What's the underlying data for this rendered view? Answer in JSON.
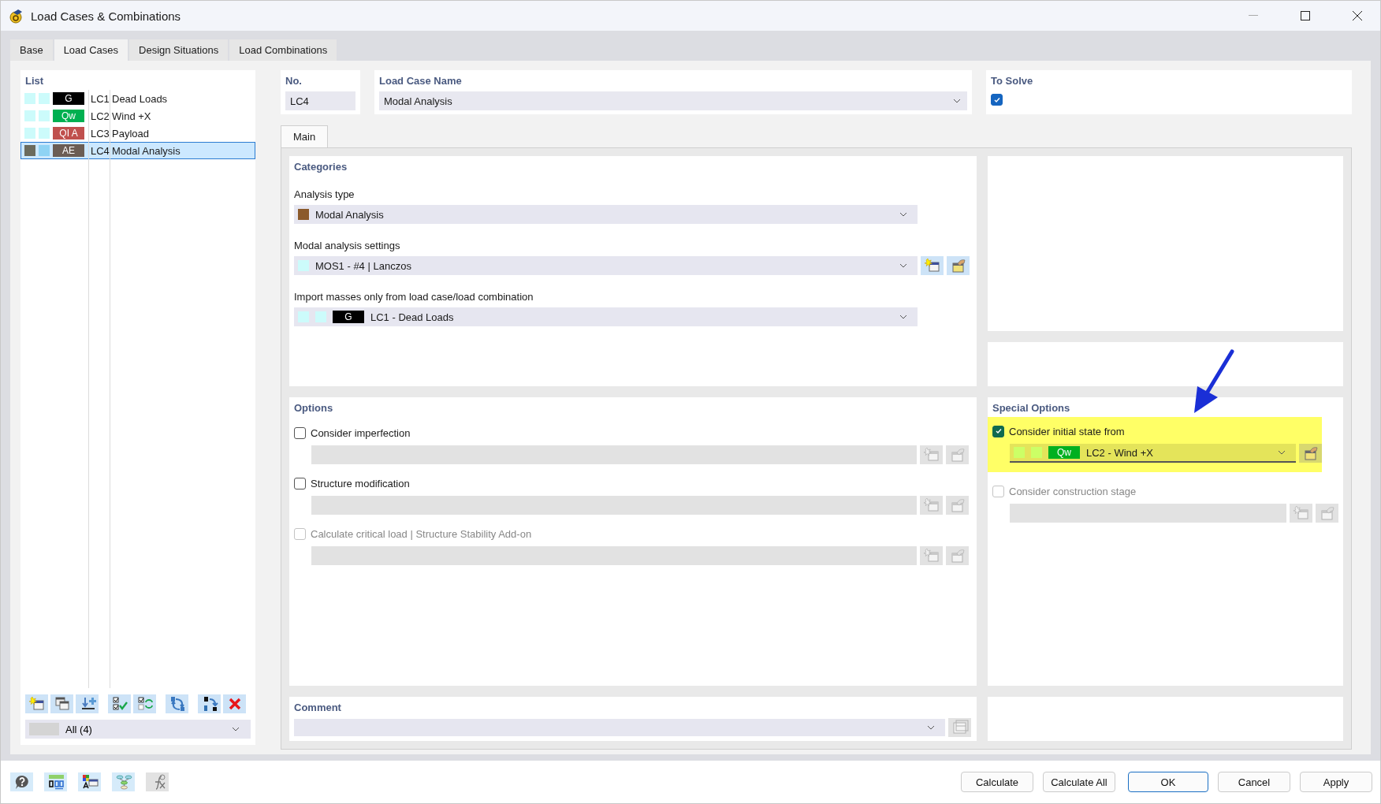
{
  "window": {
    "title": "Load Cases & Combinations"
  },
  "tabs": [
    {
      "label": "Base",
      "selected": false
    },
    {
      "label": "Load Cases",
      "selected": true
    },
    {
      "label": "Design Situations",
      "selected": false
    },
    {
      "label": "Load Combinations",
      "selected": false
    }
  ],
  "list": {
    "heading": "List",
    "items": [
      {
        "swatches": [
          {
            "color": "#ccfbfb"
          },
          {
            "color": "#ccfbfb"
          }
        ],
        "badge": {
          "text": "G",
          "color": "#000000"
        },
        "code": "LC1",
        "name": "Dead Loads",
        "selected": false
      },
      {
        "swatches": [
          {
            "color": "#ccfbfb"
          },
          {
            "color": "#ccfbfb"
          }
        ],
        "badge": {
          "text": "Qw",
          "color": "#00b050"
        },
        "code": "LC2",
        "name": "Wind +X",
        "selected": false
      },
      {
        "swatches": [
          {
            "color": "#ccfbfb"
          },
          {
            "color": "#ccfbfb"
          }
        ],
        "badge": {
          "text": "QI A",
          "color": "#c0504d"
        },
        "code": "LC3",
        "name": "Payload",
        "selected": false
      },
      {
        "swatches": [
          {
            "color": "#6b6b5e"
          },
          {
            "color": "#8fd3f4"
          }
        ],
        "badge": {
          "text": "AE",
          "color": "#6b5d54"
        },
        "code": "LC4",
        "name": "Modal Analysis",
        "selected": true
      }
    ],
    "filter": {
      "value": "All (4)"
    }
  },
  "number": {
    "label": "No.",
    "value": "LC4"
  },
  "load_case_name": {
    "label": "Load Case Name",
    "value": "Modal Analysis"
  },
  "to_solve": {
    "label": "To Solve",
    "checked": true
  },
  "section_tabs": [
    {
      "label": "Main",
      "selected": true
    }
  ],
  "categories": {
    "heading": "Categories",
    "fields": [
      {
        "label": "Analysis type",
        "value": "Modal Analysis",
        "swatches": [
          {
            "color": "#8b5a2b"
          }
        ],
        "actions": false
      },
      {
        "label": "Modal analysis settings",
        "value": "MOS1 - #4 | Lanczos",
        "swatches": [
          {
            "color": "#ccfbfb"
          }
        ],
        "actions": true
      },
      {
        "label": "Import masses only from load case/load combination",
        "value": "LC1 - Dead Loads",
        "swatches": [
          {
            "color": "#ccfbfb"
          },
          {
            "color": "#ccfbfb"
          }
        ],
        "badge": {
          "text": "G",
          "color": "#000000"
        },
        "actions": false
      }
    ]
  },
  "options": {
    "heading": "Options",
    "items": [
      {
        "label": "Consider imperfection",
        "checked": false,
        "disabled": false
      },
      {
        "label": "Structure modification",
        "checked": false,
        "disabled": false
      },
      {
        "label": "Calculate critical load | Structure Stability Add-on",
        "checked": false,
        "disabled": true
      }
    ]
  },
  "special_options": {
    "heading": "Special Options",
    "items": [
      {
        "label": "Consider initial state from",
        "checked": true,
        "disabled": false,
        "highlighted": true,
        "swatches": [
          {
            "color": "#ccff66"
          },
          {
            "color": "#ccff66"
          }
        ],
        "badge": {
          "text": "Qw",
          "color": "#00b020"
        },
        "value": "LC2 - Wind +X"
      },
      {
        "label": "Consider construction stage",
        "checked": false,
        "disabled": true,
        "highlighted": false
      }
    ]
  },
  "comment": {
    "label": "Comment"
  },
  "buttons": [
    {
      "label": "Calculate",
      "default": false
    },
    {
      "label": "Calculate All",
      "default": false
    },
    {
      "label": "OK",
      "default": true
    },
    {
      "label": "Cancel",
      "default": false
    },
    {
      "label": "Apply",
      "default": false
    }
  ]
}
